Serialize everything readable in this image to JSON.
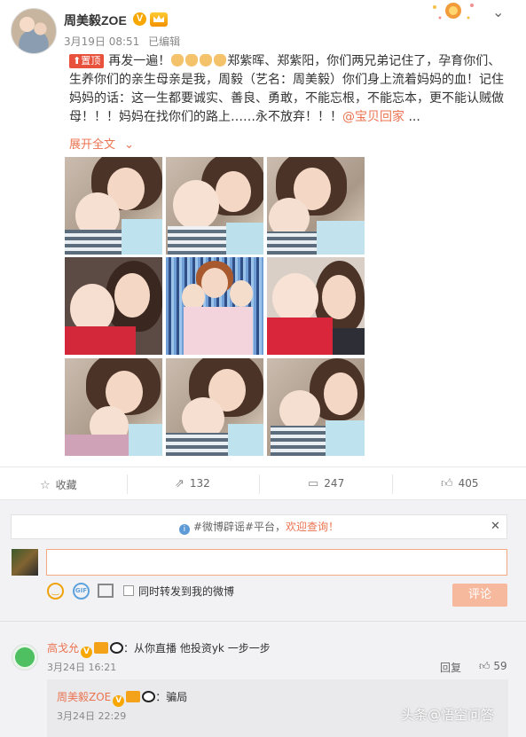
{
  "post": {
    "username": "周美毅ZOE",
    "verified_mark": "V",
    "date": "3月19日 08:51",
    "edited": "已编辑",
    "pin_tag": "置顶",
    "text_before_claps": "再发一遍！",
    "text_after_claps": "郑紫晖、郑紫阳，你们两兄弟记住了，孕育你们、生养你们的亲生母亲是我，周毅（艺名：周美毅）你们身上流着妈妈的血！记住妈妈的话：这一生都要诚实、善良、勇敢，不能忘根，不能忘本，更不能认贼做母！！！妈妈在找你们的路上……永不放弃！！！",
    "mention": "@宝贝回家",
    "ellipsis": " ...",
    "expand_label": "展开全文",
    "expand_icon": "chevron-down-icon"
  },
  "actions": {
    "favorite_label": "收藏",
    "repost_count": "132",
    "comment_count": "247",
    "like_count": "405"
  },
  "notice": {
    "prefix": "#微博辟谣#平台，",
    "link": "欢迎查询！"
  },
  "composer": {
    "forward_label": "同时转发到我的微博",
    "submit_label": "评论"
  },
  "comments": [
    {
      "name": "高戈允",
      "text": "：从你直播 他投资yk 一步一步",
      "time": "3月24日 16:21",
      "reply_label": "回复",
      "likes": "59"
    }
  ],
  "reply": {
    "name": "周美毅ZOE",
    "text": "：骗局",
    "time": "3月24日 22:29"
  },
  "watermark": "头条@悟空问答",
  "colors": {
    "accent": "#eb7350",
    "pin": "#e8513b",
    "verified": "#f7a700"
  }
}
